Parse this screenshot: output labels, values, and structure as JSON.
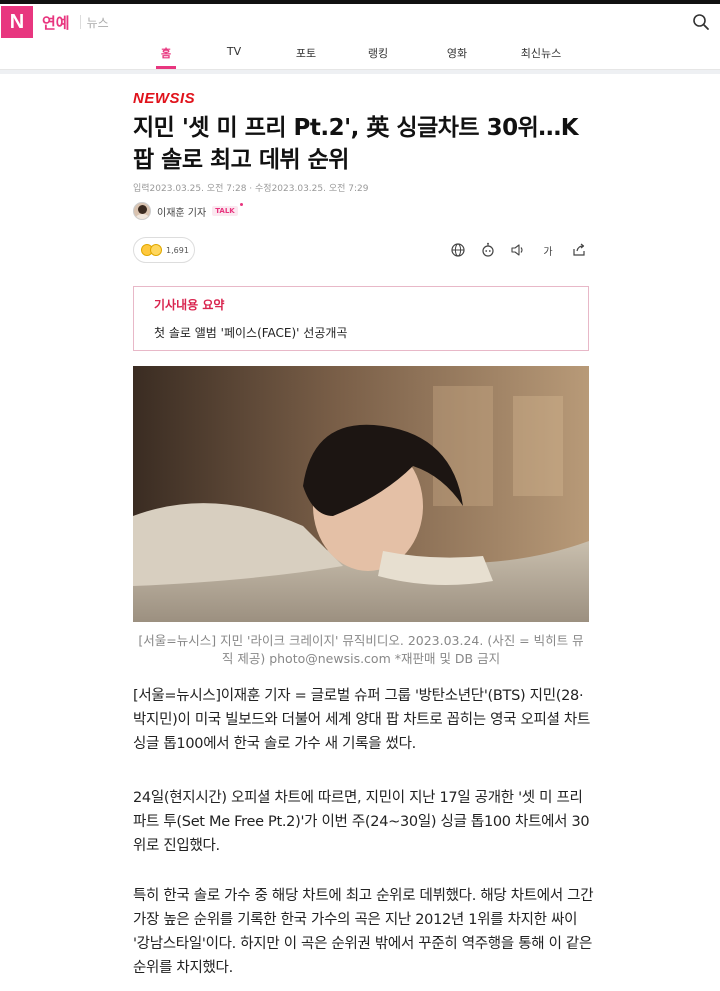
{
  "header": {
    "logo_letter": "N",
    "section": "연예",
    "sub_section": "뉴스"
  },
  "tabs": [
    {
      "label": "홈",
      "active": true
    },
    {
      "label": "TV",
      "active": false
    },
    {
      "label": "포토",
      "active": false
    },
    {
      "label": "랭킹",
      "active": false
    },
    {
      "label": "영화",
      "active": false
    },
    {
      "label": "최신뉴스",
      "active": false
    }
  ],
  "article": {
    "press": "NEWSIS",
    "headline": "지민 '셋 미 프리 Pt.2', 英 싱글차트 30위…K팝 솔로 최고 데뷔 순위",
    "dates": "입력2023.03.25. 오전 7:28 · 수정2023.03.25. 오전 7:29",
    "reporter": "이재훈 기자",
    "talk_label": "TALK",
    "reaction_count": "1,691",
    "font_size_tool_label": "가",
    "summary_title": "기사내용 요약",
    "summary_text": "첫 솔로 앨범 '페이스(FACE)' 선공개곡",
    "photo_caption": "[서울=뉴시스] 지민 '라이크 크레이지' 뮤직비디오. 2023.03.24. (사진 = 빅히트 뮤직 제공) photo@newsis.com *재판매 및 DB 금지",
    "paragraphs": [
      "[서울=뉴시스]이재훈 기자 = 글로벌 슈퍼 그룹 '방탄소년단'(BTS) 지민(28·박지민)이 미국 빌보드와 더불어 세계 양대 팝 차트로 꼽히는 영국 오피셜 차트 싱글 톱100에서 한국 솔로 가수 새 기록을 썼다.",
      "24일(현지시간) 오피셜 차트에 따르면, 지민이 지난 17일 공개한 '셋 미 프리 파트 투(Set Me Free Pt.2)'가 이번 주(24~30일) 싱글 톱100 차트에서 30위로 진입했다.",
      "특히 한국 솔로 가수 중 해당 차트에 최고 순위로 데뷔했다. 해당 차트에서 그간 가장 높은 순위를 기록한 한국 가수의 곡은 지난 2012년 1위를 차지한 싸이 '강남스타일'이다. 하지만 이 곡은 순위권 밖에서 꾸준히 역주행을 통해 이 같은 순위를 차지했다."
    ]
  },
  "colors": {
    "brand": "#e8367f",
    "press_red": "#e0121b",
    "summary_title": "#d9254f"
  },
  "icons": [
    "search-icon",
    "globe-icon",
    "audio-bot-icon",
    "speaker-icon",
    "font-size-icon",
    "share-icon"
  ]
}
